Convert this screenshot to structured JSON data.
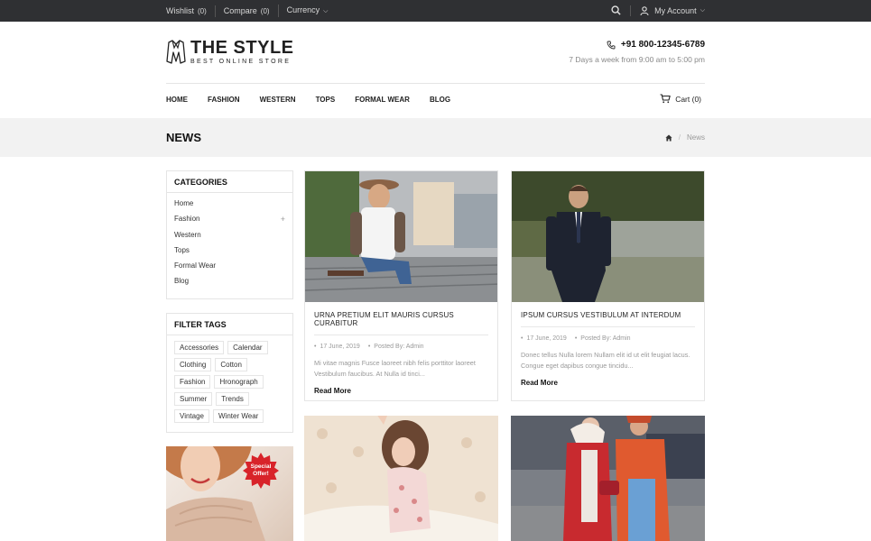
{
  "topbar": {
    "wishlist_label": "Wishlist",
    "wishlist_count": "(0)",
    "compare_label": "Compare",
    "compare_count": "(0)",
    "currency_label": "Currency",
    "account_label": "My Account"
  },
  "header": {
    "logo_title": "THE STYLE",
    "logo_subtitle": "BEST ONLINE STORE",
    "phone": "+91 800-12345-6789",
    "hours": "7 Days a week from 9:00 am to 5:00 pm"
  },
  "nav": {
    "items": [
      {
        "label": "HOME"
      },
      {
        "label": "FASHION"
      },
      {
        "label": "WESTERN"
      },
      {
        "label": "TOPS"
      },
      {
        "label": "FORMAL WEAR"
      },
      {
        "label": "BLOG"
      }
    ],
    "cart_label": "Cart (0)"
  },
  "page": {
    "title": "NEWS",
    "breadcrumb_current": "News"
  },
  "sidebar": {
    "categories_title": "CATEGORIES",
    "categories": [
      {
        "label": "Home"
      },
      {
        "label": "Fashion",
        "toggle": "+"
      },
      {
        "label": "Western"
      },
      {
        "label": "Tops"
      },
      {
        "label": "Formal Wear"
      },
      {
        "label": "Blog"
      }
    ],
    "tags_title": "FILTER TAGS",
    "tags": [
      "Accessories",
      "Calendar",
      "Clothing",
      "Cotton",
      "Fashion",
      "Hronograph",
      "Summer",
      "Trends",
      "Vintage",
      "Winter Wear"
    ],
    "promo_badge_line1": "Special",
    "promo_badge_line2": "Offer!"
  },
  "posts": [
    {
      "title": "URNA PRETIUM ELIT MAURIS CURSUS CURABITUR",
      "date": "17 June, 2019",
      "author": "Posted By: Admin",
      "excerpt": "Mi vitae magnis Fusce laoreet nibh felis porttitor laoreet Vestibulum faucibus. At Nulla id tinci...",
      "read_more": "Read More"
    },
    {
      "title": "IPSUM CURSUS VESTIBULUM AT INTERDUM",
      "date": "17 June, 2019",
      "author": "Posted By: Admin",
      "excerpt": "Donec tellus Nulla lorem Nullam elit id ut elit feugiat lacus. Congue eget dapibus congue tincidu...",
      "read_more": "Read More"
    }
  ],
  "colors": {
    "topbar_bg": "#2f3033",
    "band_bg": "#f2f2f2",
    "promo_badge": "#d8232a"
  }
}
